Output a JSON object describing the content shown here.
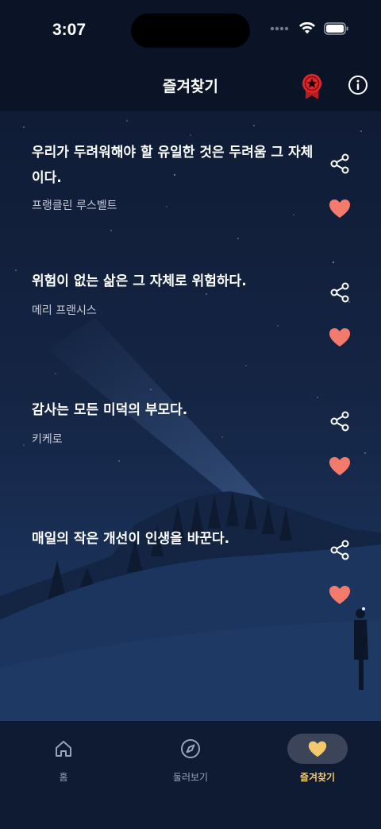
{
  "status_bar": {
    "time": "3:07"
  },
  "header": {
    "title": "즐겨찾기",
    "badge_icon": "award-icon",
    "info_icon": "info-icon"
  },
  "quotes": [
    {
      "text": "우리가 두려워해야 할 유일한 것은 두려움 그 자체이다.",
      "author": "프랭클린 루스벨트"
    },
    {
      "text": "위험이 없는 삶은 그 자체로 위험하다.",
      "author": "메리 프랜시스"
    },
    {
      "text": "감사는 모든 미덕의 부모다.",
      "author": "키케로"
    },
    {
      "text": "매일의 작은 개선이 인생을 바꾼다.",
      "author": ""
    }
  ],
  "tabs": [
    {
      "label": "홈",
      "icon": "home-icon",
      "active": false
    },
    {
      "label": "둘러보기",
      "icon": "compass-icon",
      "active": false
    },
    {
      "label": "즐겨찾기",
      "icon": "heart-icon",
      "active": true
    }
  ],
  "colors": {
    "heart": "#f47b6b",
    "active_tab": "#f4c96a",
    "badge": "#e0262b"
  }
}
